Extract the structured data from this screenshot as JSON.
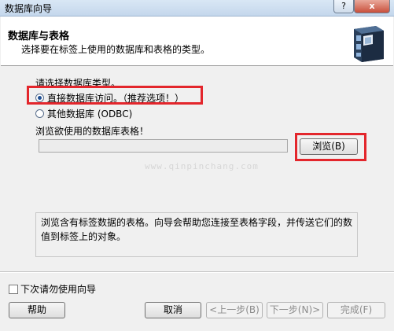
{
  "window": {
    "title": "数据库向导",
    "help_glyph": "?",
    "close_glyph": "x"
  },
  "header": {
    "title": "数据库与表格",
    "subtitle": "选择要在标签上使用的数据库和表格的类型。",
    "icon": "file-cabinet-icon"
  },
  "main": {
    "group_label": "请选择数据库类型。",
    "options": [
      {
        "label": "直接数据库访问。（推荐选项！）",
        "checked": true
      },
      {
        "label": "其他数据库 (ODBC)",
        "checked": false
      }
    ],
    "browse_label": "浏览欲使用的数据库表格！",
    "path_value": "",
    "browse_button": "浏览(B)",
    "watermark": "www.qinpinchang.com",
    "description": "浏览含有标签数据的表格。向导会帮助您连接至表格字段，并传送它们的数值到标签上的对象。"
  },
  "footer": {
    "checkbox_label": "下次请勿使用向导",
    "checkbox_checked": false,
    "buttons": {
      "help": "帮助",
      "cancel": "取消",
      "back": "<上一步(B)",
      "next": "下一步(N)>",
      "finish": "完成(F)"
    }
  },
  "colors": {
    "highlight_red": "#e3262c",
    "title_bar": "#c4d7ec",
    "close_button": "#c94f3b"
  }
}
